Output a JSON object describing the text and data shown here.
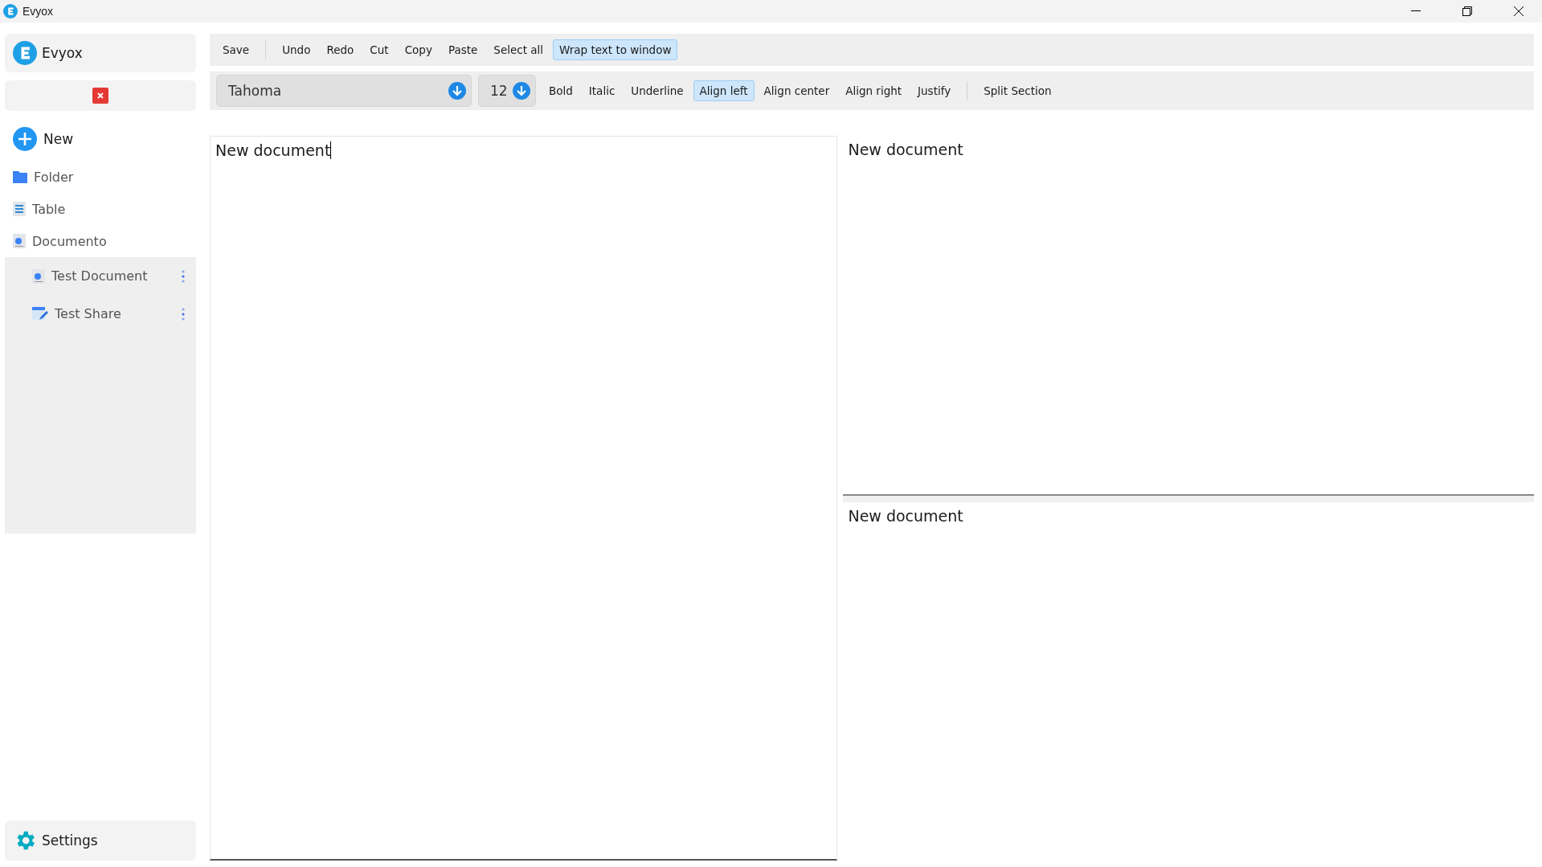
{
  "window": {
    "title": "Evyox"
  },
  "sidebar": {
    "brand": "Evyox",
    "new_label": "New",
    "items": [
      {
        "label": "Folder",
        "kind": "folder"
      },
      {
        "label": "Table",
        "kind": "table"
      },
      {
        "label": "Documento",
        "kind": "document",
        "children": [
          {
            "label": "Test Document",
            "kind": "document"
          },
          {
            "label": "Test Share",
            "kind": "share"
          }
        ]
      }
    ],
    "settings": "Settings"
  },
  "toolbar": {
    "groups": [
      [
        {
          "label": "Save",
          "on": false
        }
      ],
      [
        {
          "label": "Undo",
          "on": false
        },
        {
          "label": "Redo",
          "on": false
        },
        {
          "label": "Cut",
          "on": false
        },
        {
          "label": "Copy",
          "on": false
        },
        {
          "label": "Paste",
          "on": false
        },
        {
          "label": "Select all",
          "on": false
        },
        {
          "label": "Wrap text to window",
          "on": true
        }
      ]
    ]
  },
  "format_bar": {
    "font": "Tahoma",
    "size": "12",
    "groups": [
      [
        {
          "label": "Bold",
          "selected": false
        },
        {
          "label": "Italic",
          "selected": false
        },
        {
          "label": "Underline",
          "selected": false
        },
        {
          "label": "Align left",
          "selected": true
        },
        {
          "label": "Align center",
          "selected": false
        },
        {
          "label": "Align right",
          "selected": false
        },
        {
          "label": "Justify",
          "selected": false
        }
      ],
      [
        {
          "label": "Split Section",
          "selected": false
        }
      ]
    ]
  },
  "editors": {
    "main": {
      "text": "New document"
    },
    "split": [
      {
        "text": "New document"
      },
      {
        "text": "New document"
      }
    ]
  }
}
